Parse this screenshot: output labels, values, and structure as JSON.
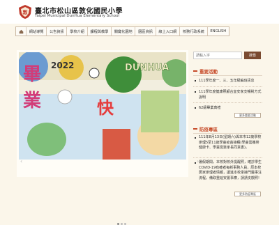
{
  "header": {
    "title_zh": "臺北市松山區敦化國民小學",
    "title_en": "Taipei Municipal DunHua Elementary School"
  },
  "nav": {
    "items": [
      "網站導覽",
      "公告資訊",
      "學校介紹",
      "課程與教學",
      "關鍵化園地",
      "園區資訊",
      "線上入口網",
      "校務行政系統",
      "ENGLISH"
    ]
  },
  "banner": {
    "line1": "畢",
    "line2": "業",
    "line3": "快",
    "year": "2022",
    "school": "DUNHUA"
  },
  "search": {
    "placeholder": "請輸入字",
    "button": "搜尋"
  },
  "important": {
    "title": "重要活動",
    "items": [
      "111學年度一、三、五年級編班訊息",
      "111學年度健康照顧合宜安家支暢對方式說明",
      "62級畢業典禮"
    ],
    "more": "更多重要活動"
  },
  "epidemic": {
    "title": "防疫專區",
    "items": [
      "111年8月13日(星期六)與本市12歲學校辦理5至11歲學童疫苗接種(學童需攜帶健康卡、學童需簽家長同意書)。",
      "暑假期間，本校對校外提醒照，確診學生COVID-19有確者每新事務人員，原本校居家辦理者情報，讓進本校承接門醫事注流程，備取重延安置事療，請請支觀照!"
    ],
    "more": "更多防疫專區"
  }
}
